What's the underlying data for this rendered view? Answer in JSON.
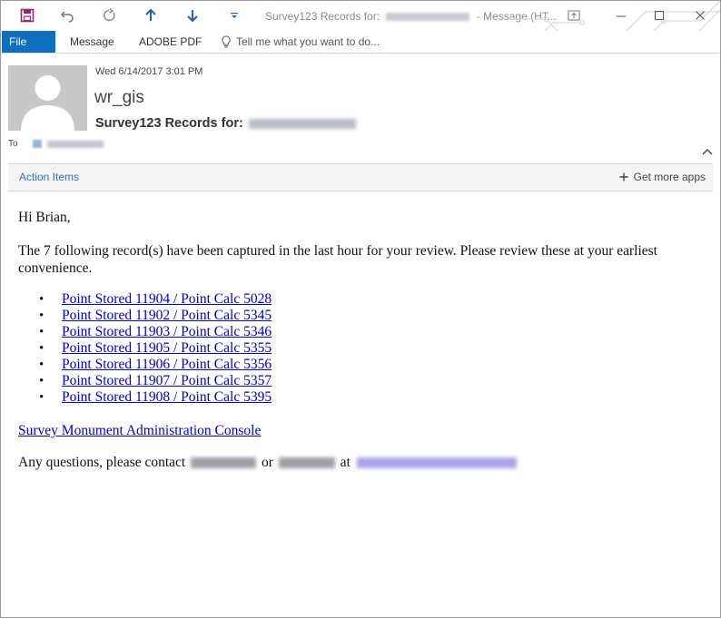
{
  "window": {
    "title_prefix": "Survey123 Records for:",
    "title_suffix": "- Message (HT..."
  },
  "tabs": {
    "file": "File",
    "message": "Message",
    "adobe_pdf": "ADOBE PDF",
    "tell_me": "Tell me what you want to do..."
  },
  "header": {
    "date": "Wed 6/14/2017 3:01 PM",
    "sender": "wr_gis",
    "subject": "Survey123 Records for:",
    "to_label": "To"
  },
  "actionbar": {
    "action_items": "Action Items",
    "get_more_apps": "Get more apps"
  },
  "body": {
    "greeting": "Hi Brian,",
    "paragraph": "The 7 following record(s) have been captured in the last hour for your review. Please review these at your earliest convenience.",
    "records": [
      "Point Stored 11904 / Point Calc 5028",
      "Point Stored 11902 / Point Calc 5345",
      "Point Stored 11903 / Point Calc 5346",
      "Point Stored 11905 / Point Calc 5355",
      "Point Stored 11906 / Point Calc 5356",
      "Point Stored 11907 / Point Calc 5357",
      "Point Stored 11908 / Point Calc 5395"
    ],
    "console_link": "Survey Monument Administration Console",
    "contact_prefix": "Any questions, please contact",
    "contact_or": "or",
    "contact_at": "at"
  },
  "colors": {
    "file_tab": "#106ebe",
    "link": "#0000cc",
    "accent": "#2e75b6",
    "qat_icon": "#1e64b4"
  },
  "icons": [
    "save-icon",
    "undo-icon",
    "redo-icon",
    "up-arrow-icon",
    "down-arrow-icon",
    "customize-icon",
    "restore-icon",
    "minimize-icon",
    "maximize-icon",
    "close-icon",
    "lightbulb-icon",
    "collapse-chevron-icon",
    "plus-icon"
  ]
}
